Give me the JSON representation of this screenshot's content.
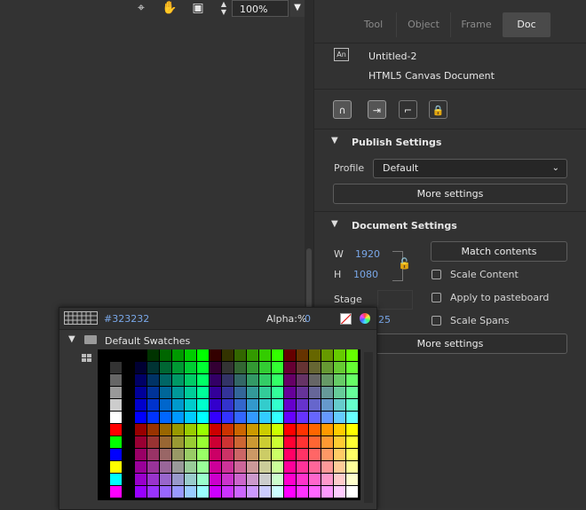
{
  "toolbar": {
    "icons": [
      "crosshair-icon",
      "hand-rotate-icon",
      "clip-icon"
    ],
    "zoom_value": "100%"
  },
  "panel": {
    "tabs": [
      {
        "label": "Tool",
        "active": false
      },
      {
        "label": "Object",
        "active": false
      },
      {
        "label": "Frame",
        "active": false
      },
      {
        "label": "Doc",
        "active": true
      }
    ],
    "doc": {
      "icon_text": "An",
      "title": "Untitled-2",
      "type": "HTML5 Canvas Document"
    },
    "snap_icons": [
      "magnet-icon",
      "pin-icon",
      "ruler-corner-icon",
      "lock-icon"
    ],
    "publish": {
      "header": "Publish Settings",
      "profile_label": "Profile",
      "profile_value": "Default",
      "more_settings": "More settings"
    },
    "document_settings": {
      "header": "Document Settings",
      "w_label": "W",
      "w_value": "1920",
      "h_label": "H",
      "h_value": "1080",
      "match_contents": "Match contents",
      "scale_content": "Scale Content",
      "apply_pasteboard": "Apply to pasteboard",
      "scale_spans": "Scale Spans",
      "stage_label": "Stage",
      "fps_value": "25",
      "more_settings": "More settings"
    }
  },
  "swatches_popup": {
    "hex": "#323232",
    "alpha_label": "Alpha:%",
    "alpha_value": "0",
    "library_name": "Default Swatches"
  },
  "colors": {
    "panel_bg": "#323232",
    "accent_blue": "#79a7e8",
    "stage_bg": "#333333"
  }
}
